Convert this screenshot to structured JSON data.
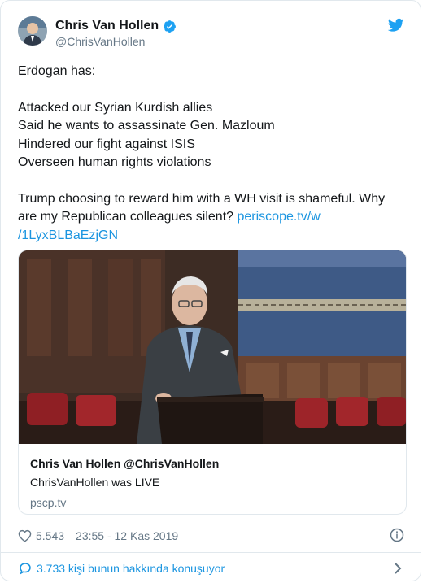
{
  "author": {
    "name": "Chris Van Hollen",
    "handle": "@ChrisVanHollen",
    "avatar_icon": "avatar-icon",
    "verified_icon": "verified-badge-icon"
  },
  "tweet": {
    "line1": "Erdogan has:",
    "bullets": [
      "Attacked our Syrian Kurdish allies",
      "Said he wants to assassinate Gen. Mazloum",
      "Hindered our fight against ISIS",
      "Overseen human rights violations"
    ],
    "closing": "Trump choosing to reward him with a WH visit is shameful. Why are my Republican colleagues silent? ",
    "link_part1": "periscope.tv/w",
    "link_part2": "/1LyxBLBaEzjGN"
  },
  "card": {
    "title": "Chris Van Hollen @ChrisVanHollen",
    "description": "ChrisVanHollen was LIVE",
    "domain": "pscp.tv"
  },
  "meta": {
    "likes": "5.543",
    "timestamp": "23:55 - 12 Kas 2019"
  },
  "footer": {
    "conversation": "3.733 kişi bunun hakkında konuşuyor"
  },
  "colors": {
    "link": "#1b95e0",
    "verified": "#1da1f2",
    "secondary_text": "#657786"
  }
}
